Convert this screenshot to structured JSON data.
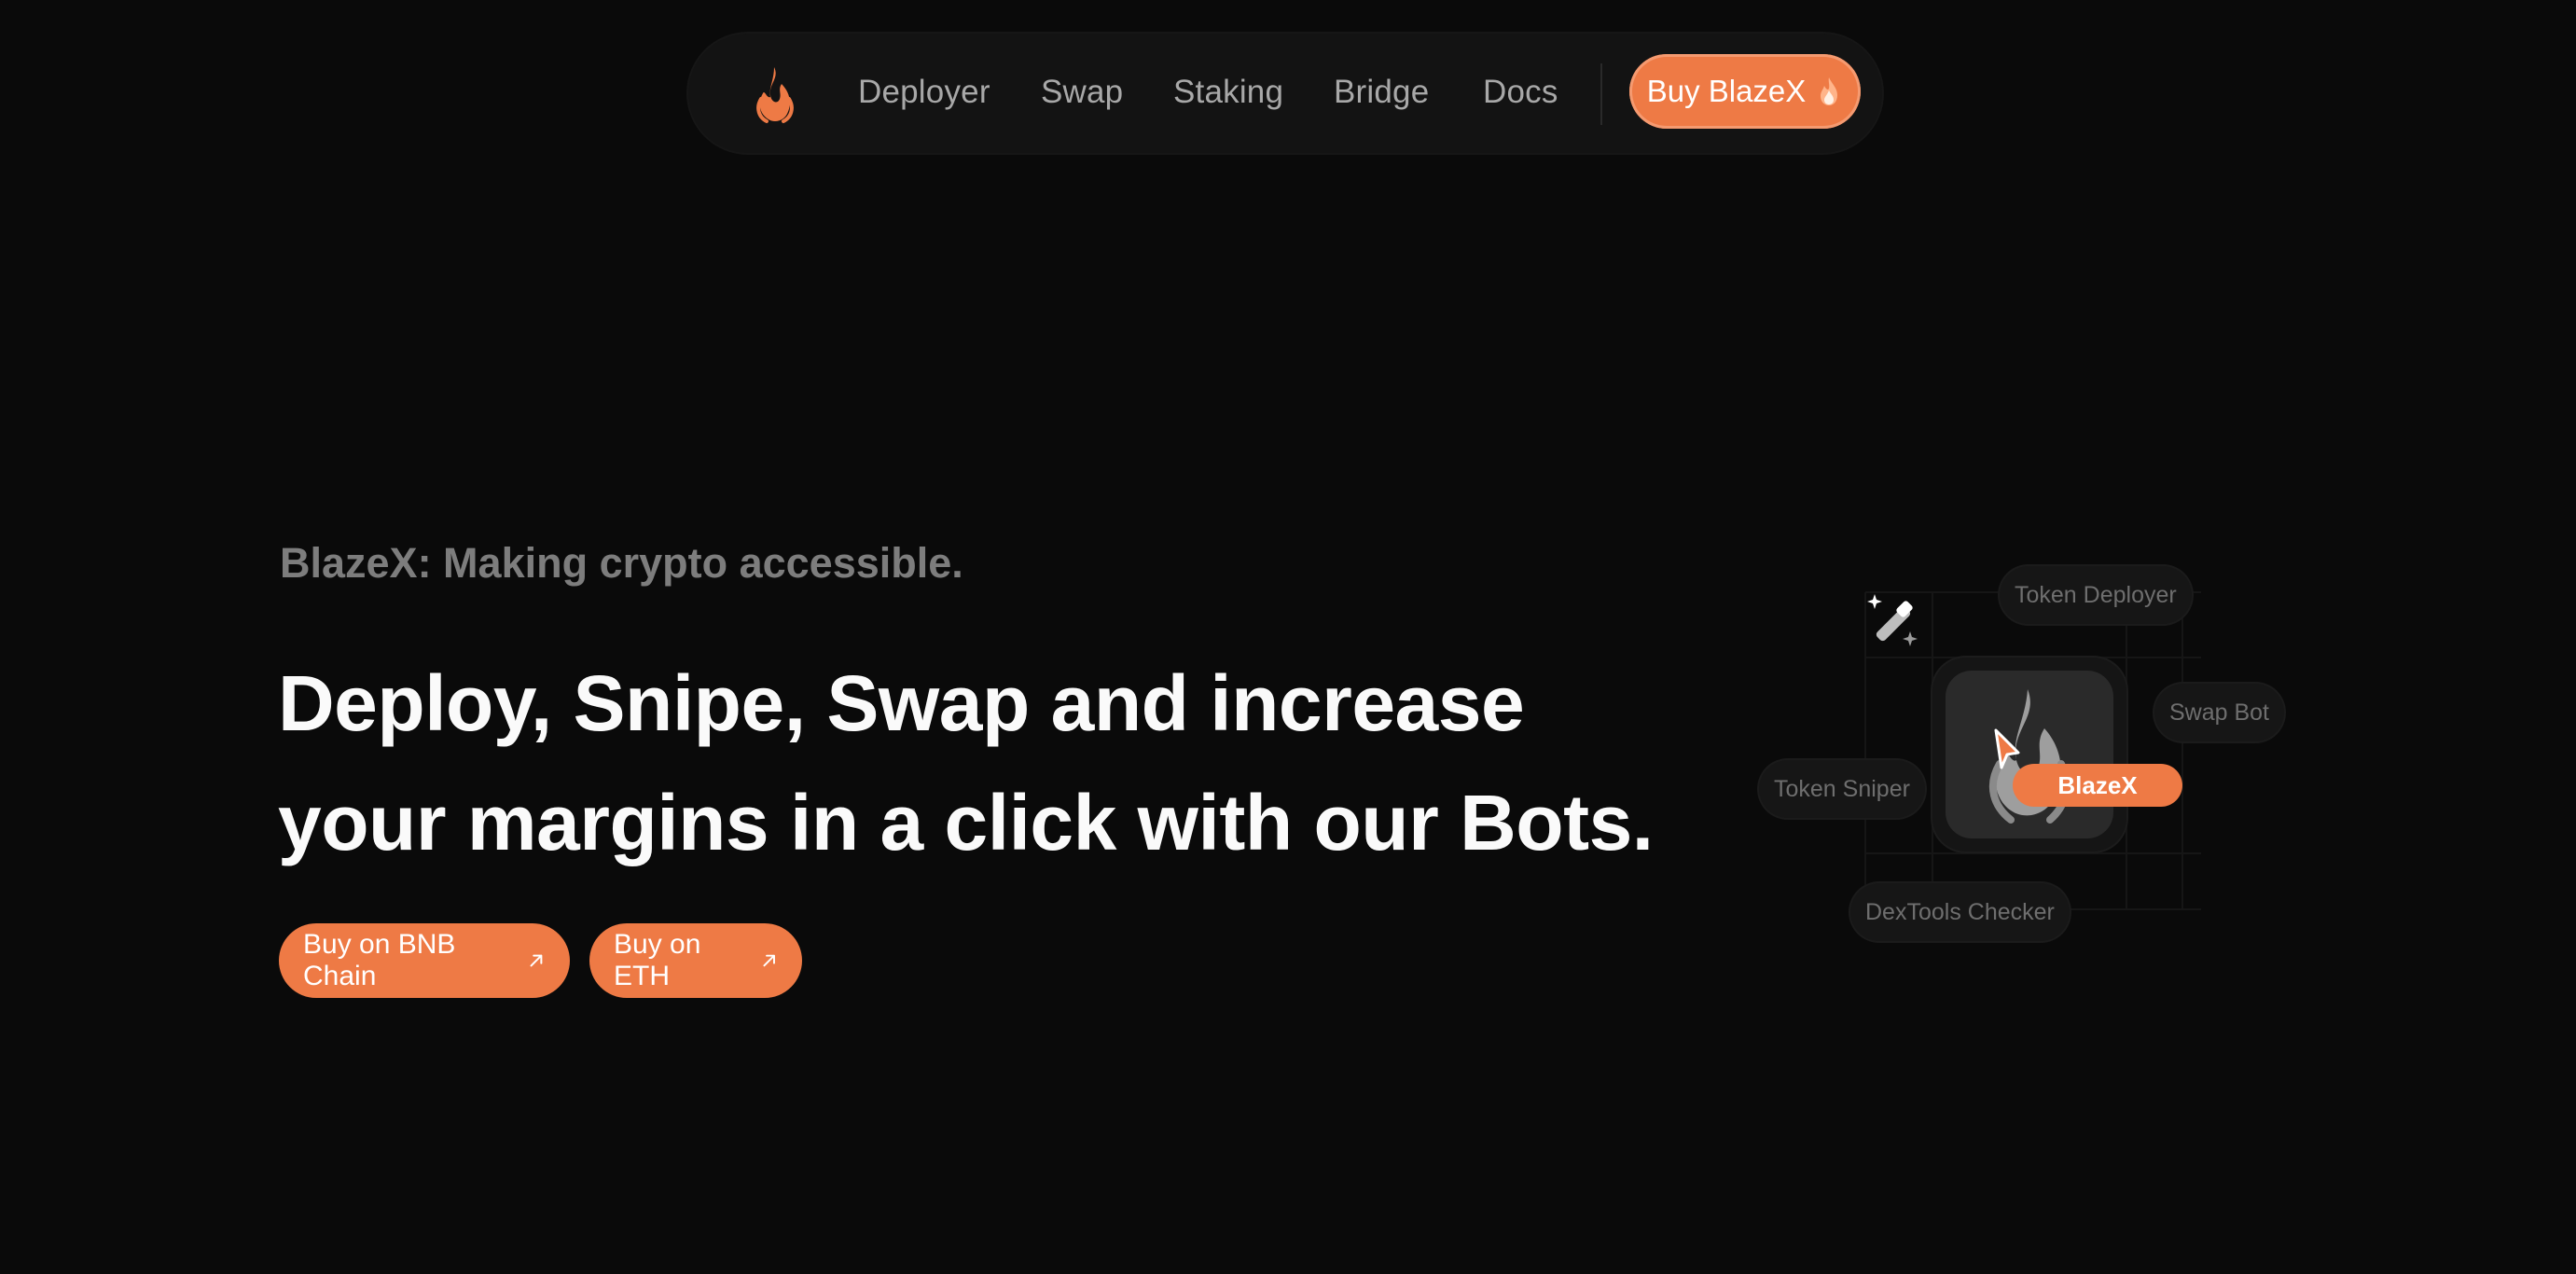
{
  "nav": {
    "logo": "blazex-flame-logo",
    "links": [
      "Deployer",
      "Swap",
      "Staking",
      "Bridge",
      "Docs"
    ],
    "buy_label": "Buy BlazeX",
    "buy_icon": "fire-icon"
  },
  "hero": {
    "tagline": "BlazeX: Making crypto accessible.",
    "headline_line1": "Deploy, Snipe, Swap and increase",
    "headline_line2": "your margins in a click with our Bots.",
    "cta_bnb": "Buy on BNB Chain",
    "cta_eth": "Buy on ETH",
    "cta_icon": "arrow-up-right-icon"
  },
  "illustration": {
    "pills": {
      "token_deployer": "Token Deployer",
      "swap_bot": "Swap Bot",
      "token_sniper": "Token Sniper",
      "dextools_checker": "DexTools Checker"
    },
    "brand_badge": "BlazeX",
    "wand_icon": "magic-wand-icon"
  },
  "colors": {
    "background": "#0a0a0a",
    "accent": "#ee7a45",
    "nav_bg": "#131313",
    "muted_text": "#a8a8a8"
  }
}
